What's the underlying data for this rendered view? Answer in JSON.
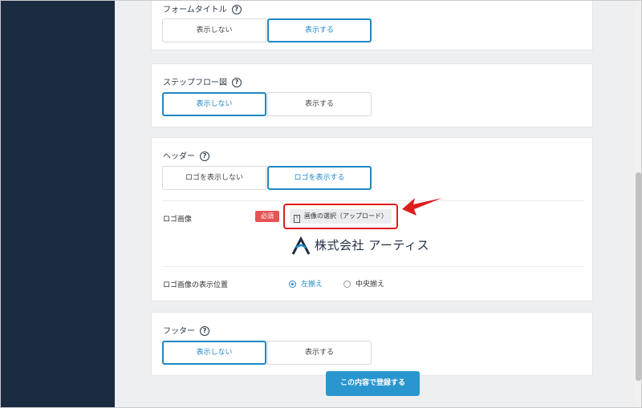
{
  "form_title_section": {
    "title": "フォームタイトル",
    "options": [
      "表示しない",
      "表示する"
    ],
    "selected": "表示する"
  },
  "step_flow_section": {
    "title": "ステップフロー図",
    "options": [
      "表示しない",
      "表示する"
    ],
    "selected": "表示しない"
  },
  "header_section": {
    "title": "ヘッダー",
    "options": [
      "ロゴを表示しない",
      "ロゴを表示する"
    ],
    "selected": "ロゴを表示する",
    "logo_image": {
      "label": "ロゴ画像",
      "required_badge": "必須",
      "upload_button": "画像の選択（アップロード）",
      "logo_text": "株式会社 アーティス"
    },
    "logo_position": {
      "label": "ロゴ画像の表示位置",
      "options": [
        "左揃え",
        "中央揃え"
      ],
      "selected": "左揃え"
    }
  },
  "footer_section": {
    "title": "フッター",
    "options": [
      "表示しない",
      "表示する"
    ],
    "selected": "表示しない"
  },
  "submit_button": "この内容で登録する",
  "help_glyph": "?",
  "colors": {
    "sidebar": "#1b2b42",
    "accent": "#1f87c6",
    "required": "#e55353",
    "highlight": "#e01b1b",
    "submit": "#2a96cf"
  }
}
